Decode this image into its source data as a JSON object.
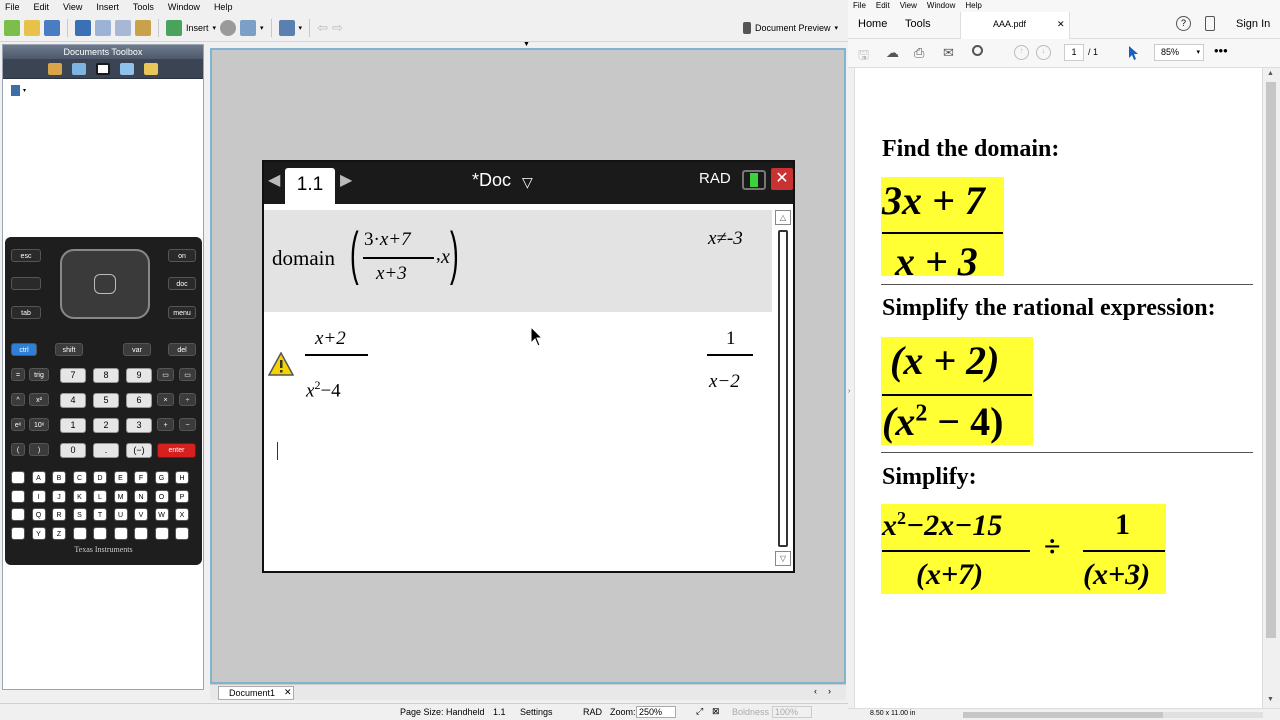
{
  "ti": {
    "menu": [
      "File",
      "Edit",
      "View",
      "Insert",
      "Tools",
      "Window",
      "Help"
    ],
    "toolbar": {
      "insert_label": "Insert",
      "doc_preview_label": "Document Preview"
    },
    "toolbox_title": "Documents Toolbox",
    "calculator": {
      "brand": "Texas Instruments",
      "keys": {
        "esc": "esc",
        "on": "on",
        "doc": "doc",
        "menu": "menu",
        "tab": "tab",
        "ctrl": "ctrl",
        "shift": "shift",
        "var": "var",
        "del": "del",
        "trig": "trig",
        "enter": "enter"
      },
      "digits": [
        "7",
        "8",
        "9",
        "4",
        "5",
        "6",
        "1",
        "2",
        "3",
        "0",
        ".",
        "(−)"
      ],
      "ops": [
        "×",
        "÷",
        "+",
        "−"
      ],
      "letters": [
        "A",
        "B",
        "C",
        "D",
        "E",
        "F",
        "G",
        "H",
        "I",
        "J",
        "K",
        "L",
        "M",
        "N",
        "O",
        "P",
        "Q",
        "R",
        "S",
        "T",
        "U",
        "V",
        "W",
        "X",
        "Y",
        "Z"
      ]
    },
    "handheld": {
      "page_tab": "1.1",
      "doc_title": "*Doc",
      "angle_mode": "RAD",
      "close": "✕",
      "entry1": {
        "fn": "domain",
        "num_coef": "3",
        "num_rest": "x+7",
        "den": "x+3",
        "var": "x",
        "result": "x≠-3"
      },
      "entry2": {
        "num": "x+2",
        "den_base": "x",
        "den_exp": "2",
        "den_rest": "−4",
        "res_num": "1",
        "res_den": "x−2"
      }
    },
    "doc_tab": "Document1",
    "status": {
      "page_size": "Page Size: Handheld",
      "page": "1.1",
      "settings": "Settings",
      "angle": "RAD",
      "zoom_label": "Zoom:",
      "zoom": "250%",
      "boldness": "Boldness",
      "boldness_val": "100%"
    }
  },
  "pdf": {
    "menu": [
      "File",
      "Edit",
      "View",
      "Window",
      "Help"
    ],
    "nav": {
      "home": "Home",
      "tools": "Tools",
      "tab": "AAA.pdf",
      "sign_in": "Sign In"
    },
    "page_current": "1",
    "page_total": "/ 1",
    "zoom": "85%",
    "content": {
      "q1_heading": "Find the domain:",
      "q1_num": "3x + 7",
      "q1_den": "x + 3",
      "q2_heading": "Simplify the rational expression:",
      "q2_num": "(x + 2)",
      "q2_den_open": "(x",
      "q2_den_exp": "2",
      "q2_den_rest": " − 4)",
      "q3_heading": "Simplify:",
      "q3_num_a": "x",
      "q3_num_exp": "2",
      "q3_num_b": "−2x−15",
      "q3_den_a": "(x+7)",
      "q3_op": "÷",
      "q3_num2": "1",
      "q3_den2": "(x+3)"
    },
    "page_size": "8.50 x 11.00 in"
  },
  "colors": {
    "highlight": "#ffff33",
    "ti_frame": "#7fb3cf",
    "close_red": "#c83232",
    "enter_red": "#d62020"
  }
}
